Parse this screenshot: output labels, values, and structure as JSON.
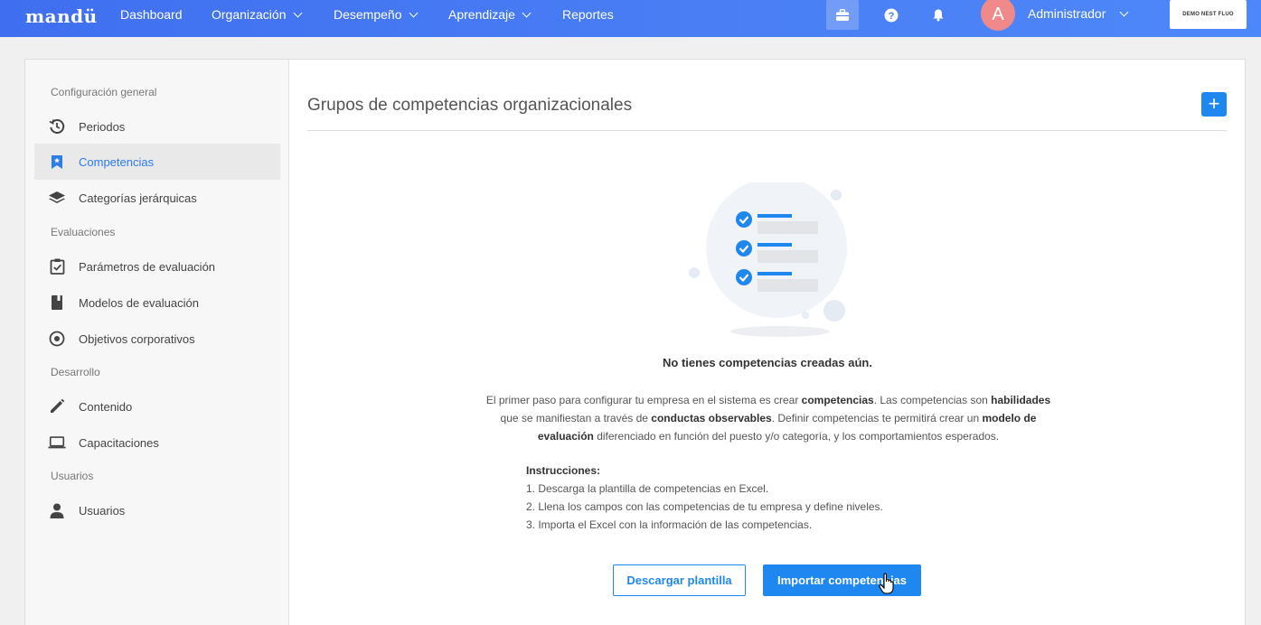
{
  "nav": {
    "logo": "mandü",
    "items": [
      {
        "label": "Dashboard"
      },
      {
        "label": "Organización"
      },
      {
        "label": "Desempeño"
      },
      {
        "label": "Aprendizaje"
      },
      {
        "label": "Reportes"
      }
    ],
    "user_initial": "A",
    "user_name": "Administrador",
    "company": "DEMO NEST FLUO"
  },
  "sidebar": {
    "sections": [
      {
        "title": "Configuración general"
      },
      {
        "title": "Evaluaciones"
      },
      {
        "title": "Desarrollo"
      },
      {
        "title": "Usuarios"
      }
    ],
    "items": [
      {
        "label": "Periodos",
        "icon": "history-icon"
      },
      {
        "label": "Competencias",
        "icon": "bookmark-star-icon",
        "active": true
      },
      {
        "label": "Categorías jerárquicas",
        "icon": "layers-icon"
      },
      {
        "label": "Parámetros de evaluación",
        "icon": "checklist-icon"
      },
      {
        "label": "Modelos de evaluación",
        "icon": "book-icon"
      },
      {
        "label": "Objetivos corporativos",
        "icon": "target-icon"
      },
      {
        "label": "Contenido",
        "icon": "pencil-icon"
      },
      {
        "label": "Capacitaciones",
        "icon": "laptop-icon"
      },
      {
        "label": "Usuarios",
        "icon": "user-icon"
      }
    ]
  },
  "main": {
    "title": "Grupos de competencias organizacionales",
    "add_label": "+",
    "empty_title": "No tienes competencias creadas aún.",
    "desc": {
      "p1": "El primer paso para configurar tu empresa en el sistema es crear ",
      "b1": "competencias",
      "p2": ". Las competencias son ",
      "b2": "habilidades",
      "p3": " que se manifiestan a través de ",
      "b3": "conductas observables",
      "p4": ". Definir competencias te permitirá crear un ",
      "b4": "modelo de evaluación",
      "p5": " diferenciado en función del puesto y/o categoría, y los comportamientos esperados."
    },
    "instructions": {
      "heading": "Instrucciones:",
      "steps": [
        "1. Descarga la plantilla de competencias en Excel.",
        "2. Llena los campos con las competencias de tu empresa y define niveles.",
        "3. Importa el Excel con la información de las competencias."
      ]
    },
    "download_label": "Descargar plantilla",
    "import_label": "Importar competencias"
  },
  "colors": {
    "accent": "#1e88f0",
    "nav": "#4a7ff5"
  }
}
